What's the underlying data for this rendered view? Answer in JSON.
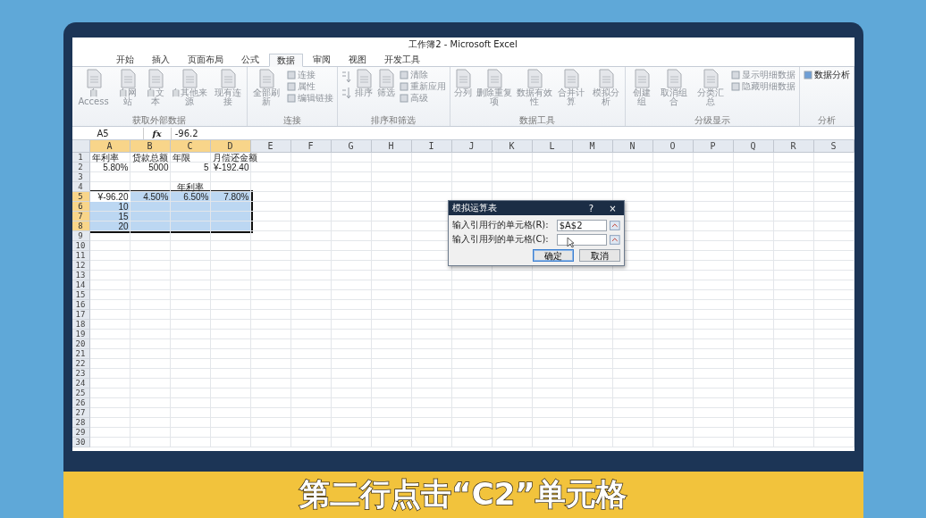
{
  "window": {
    "title": "工作簿2 - Microsoft Excel"
  },
  "tabs": [
    {
      "label": "开始",
      "selected": false
    },
    {
      "label": "插入",
      "selected": false
    },
    {
      "label": "页面布局",
      "selected": false
    },
    {
      "label": "公式",
      "selected": false
    },
    {
      "label": "数据",
      "selected": true
    },
    {
      "label": "审阅",
      "selected": false
    },
    {
      "label": "视图",
      "selected": false
    },
    {
      "label": "开发工具",
      "selected": false
    }
  ],
  "ribbon": [
    {
      "label": "获取外部数据",
      "items": [
        {
          "kind": "large",
          "label": "自 Access",
          "disabled": true
        },
        {
          "kind": "large",
          "label": "自网站",
          "disabled": true
        },
        {
          "kind": "large",
          "label": "自文本",
          "disabled": true
        },
        {
          "kind": "large",
          "label": "自其他来源",
          "disabled": true
        },
        {
          "kind": "large",
          "label": "现有连接",
          "disabled": true
        }
      ]
    },
    {
      "label": "连接",
      "items": [
        {
          "kind": "large",
          "label": "全部刷新",
          "disabled": true
        },
        {
          "kind": "stack",
          "items": [
            {
              "label": "连接",
              "disabled": true
            },
            {
              "label": "属性",
              "disabled": true
            },
            {
              "label": "编辑链接",
              "disabled": true
            }
          ]
        }
      ]
    },
    {
      "label": "排序和筛选",
      "items": [
        {
          "kind": "sort"
        },
        {
          "kind": "large",
          "label": "排序",
          "disabled": true
        },
        {
          "kind": "large",
          "label": "筛选",
          "disabled": true
        },
        {
          "kind": "stack",
          "items": [
            {
              "label": "清除",
              "disabled": true
            },
            {
              "label": "重新应用",
              "disabled": true
            },
            {
              "label": "高级",
              "disabled": true
            }
          ]
        }
      ]
    },
    {
      "label": "数据工具",
      "items": [
        {
          "kind": "large",
          "label": "分列",
          "disabled": true
        },
        {
          "kind": "large",
          "label": "删除重复项",
          "disabled": true
        },
        {
          "kind": "large",
          "label": "数据有效性",
          "disabled": true
        },
        {
          "kind": "large",
          "label": "合并计算",
          "disabled": true
        },
        {
          "kind": "large",
          "label": "模拟分析",
          "disabled": true
        }
      ]
    },
    {
      "label": "分级显示",
      "items": [
        {
          "kind": "large",
          "label": "创建组",
          "disabled": true
        },
        {
          "kind": "large",
          "label": "取消组合",
          "disabled": true
        },
        {
          "kind": "large",
          "label": "分类汇总",
          "disabled": true
        },
        {
          "kind": "stack",
          "items": [
            {
              "label": "显示明细数据",
              "disabled": true
            },
            {
              "label": "隐藏明细数据",
              "disabled": true
            }
          ]
        }
      ]
    },
    {
      "label": "分析",
      "items": [
        {
          "kind": "stack",
          "items": [
            {
              "label": "数据分析",
              "disabled": false
            }
          ]
        }
      ]
    }
  ],
  "formula_bar": {
    "name_box": "A5",
    "fx": "fx",
    "formula": "-96.2"
  },
  "columns": [
    {
      "label": "A",
      "selected": true
    },
    {
      "label": "B",
      "selected": true
    },
    {
      "label": "C",
      "selected": true
    },
    {
      "label": "D",
      "selected": true
    },
    {
      "label": "E",
      "selected": false
    },
    {
      "label": "F",
      "selected": false
    },
    {
      "label": "G",
      "selected": false
    },
    {
      "label": "H",
      "selected": false
    },
    {
      "label": "I",
      "selected": false
    },
    {
      "label": "J",
      "selected": false
    },
    {
      "label": "K",
      "selected": false
    },
    {
      "label": "L",
      "selected": false
    },
    {
      "label": "M",
      "selected": false
    },
    {
      "label": "N",
      "selected": false
    },
    {
      "label": "O",
      "selected": false
    },
    {
      "label": "P",
      "selected": false
    },
    {
      "label": "Q",
      "selected": false
    },
    {
      "label": "R",
      "selected": false
    },
    {
      "label": "S",
      "selected": false
    }
  ],
  "rows": [
    {
      "label": "1",
      "selected": false,
      "kind": "header",
      "cells": [
        {
          "text": "年利率",
          "active": false
        },
        {
          "text": "贷款总额",
          "active": false
        },
        {
          "text": "年限",
          "active": false
        },
        {
          "text": "月偿还金额",
          "active": false
        }
      ]
    },
    {
      "label": "2",
      "selected": false,
      "kind": "number",
      "cells": [
        {
          "text": "5.80%",
          "active": false
        },
        {
          "text": "5000",
          "active": false
        },
        {
          "text": "5",
          "active": false
        },
        {
          "text": "¥-192.40",
          "active": false
        }
      ]
    },
    {
      "label": "3",
      "selected": false,
      "kind": "blank",
      "cells": []
    },
    {
      "label": "4",
      "selected": false,
      "kind": "title",
      "cells": [
        null,
        null,
        {
          "text": "年利率",
          "active": false
        }
      ]
    },
    {
      "label": "5",
      "selected": true,
      "kind": "number",
      "cells": [
        {
          "text": "¥-96.20",
          "active": true
        },
        {
          "text": "4.50%",
          "active": false
        },
        {
          "text": "6.50%",
          "active": false
        },
        {
          "text": "7.80%",
          "active": false
        }
      ]
    },
    {
      "label": "6",
      "selected": true,
      "kind": "number",
      "cells": [
        {
          "text": "10",
          "active": false
        }
      ]
    },
    {
      "label": "7",
      "selected": true,
      "kind": "number",
      "cells": [
        {
          "text": "15",
          "active": false
        }
      ]
    },
    {
      "label": "8",
      "selected": true,
      "kind": "number",
      "cells": [
        {
          "text": "20",
          "active": false
        }
      ]
    },
    {
      "label": "9",
      "selected": false,
      "kind": "blank",
      "cells": []
    },
    {
      "label": "10",
      "selected": false,
      "kind": "blank",
      "cells": []
    },
    {
      "label": "11",
      "selected": false,
      "kind": "blank",
      "cells": []
    },
    {
      "label": "12",
      "selected": false,
      "kind": "blank",
      "cells": []
    },
    {
      "label": "13",
      "selected": false,
      "kind": "blank",
      "cells": []
    },
    {
      "label": "14",
      "selected": false,
      "kind": "blank",
      "cells": []
    },
    {
      "label": "15",
      "selected": false,
      "kind": "blank",
      "cells": []
    },
    {
      "label": "16",
      "selected": false,
      "kind": "blank",
      "cells": []
    },
    {
      "label": "17",
      "selected": false,
      "kind": "blank",
      "cells": []
    },
    {
      "label": "18",
      "selected": false,
      "kind": "blank",
      "cells": []
    },
    {
      "label": "19",
      "selected": false,
      "kind": "blank",
      "cells": []
    },
    {
      "label": "20",
      "selected": false,
      "kind": "blank",
      "cells": []
    },
    {
      "label": "21",
      "selected": false,
      "kind": "blank",
      "cells": []
    },
    {
      "label": "22",
      "selected": false,
      "kind": "blank",
      "cells": []
    },
    {
      "label": "23",
      "selected": false,
      "kind": "blank",
      "cells": []
    },
    {
      "label": "24",
      "selected": false,
      "kind": "blank",
      "cells": []
    },
    {
      "label": "25",
      "selected": false,
      "kind": "blank",
      "cells": []
    },
    {
      "label": "26",
      "selected": false,
      "kind": "blank",
      "cells": []
    },
    {
      "label": "27",
      "selected": false,
      "kind": "blank",
      "cells": []
    },
    {
      "label": "28",
      "selected": false,
      "kind": "blank",
      "cells": []
    },
    {
      "label": "29",
      "selected": false,
      "kind": "blank",
      "cells": []
    },
    {
      "label": "30",
      "selected": false,
      "kind": "blank",
      "cells": []
    }
  ],
  "dialog": {
    "title": "模拟运算表",
    "help": "?",
    "close": "×",
    "fields": [
      {
        "label": "输入引用行的单元格(R):",
        "value": "$A$2"
      },
      {
        "label": "输入引用列的单元格(C):"
      }
    ],
    "buttons": [
      {
        "label": "确定",
        "default": true
      },
      {
        "label": "取消",
        "default": false
      }
    ]
  },
  "caption": "第二行点击“C2”单元格"
}
